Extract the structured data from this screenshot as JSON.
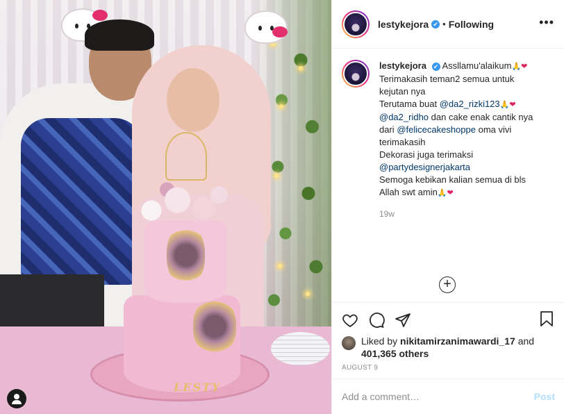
{
  "post": {
    "username": "lestykejora",
    "verified_mark": "✔",
    "dot": "•",
    "follow_status": "Following",
    "more_label": "•••"
  },
  "caption": {
    "username": "lestykejora",
    "lines": [
      "Assllamu'alaikum",
      "Terimakasih teman2 semua untuk",
      "kejutan nya",
      "Terutama buat",
      "@da2_rizki123",
      "@da2_ridho",
      "dan cake enak cantik nya",
      "dari",
      "@felicecakeshoppe",
      "oma vivi",
      "terimakasih",
      "Dekorasi juga terimaksi",
      "@partydesignerjakarta",
      "Semoga kebikan kalian semua di bls",
      "Allah swt amin"
    ],
    "emoji": "🙏❤",
    "time_ago": "19w",
    "load_more": "+"
  },
  "likes": {
    "prefix": "Liked by",
    "user": "nikitamirzanimawardi_17",
    "and": "and",
    "others": "401,365 others"
  },
  "date": "AUGUST 9",
  "comment": {
    "placeholder": "Add a comment…",
    "post_label": "Post"
  },
  "photo": {
    "cake_text": "LESTY"
  },
  "colors": {
    "verified": "#3897f0",
    "mention": "#00376b",
    "muted": "#8e8e8e",
    "post_disabled": "#b2dffc"
  },
  "icons": [
    "heart-icon",
    "comment-icon",
    "share-icon",
    "bookmark-icon",
    "user-tag-icon",
    "plus-circle-icon",
    "more-icon"
  ]
}
